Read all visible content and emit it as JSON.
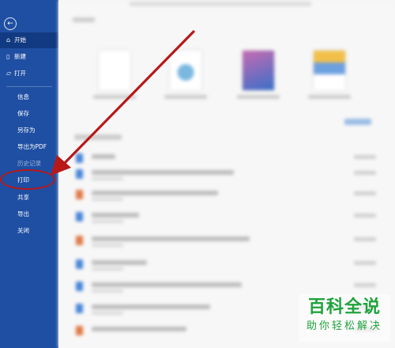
{
  "sidebar": {
    "back_icon": "back-arrow-icon",
    "items": [
      {
        "label": "开始",
        "icon": "home-icon",
        "glyph": "⌂"
      },
      {
        "label": "新建",
        "icon": "new-file-icon",
        "glyph": "▯"
      },
      {
        "label": "打开",
        "icon": "open-folder-icon",
        "glyph": "▱"
      },
      {
        "label": "信息"
      },
      {
        "label": "保存"
      },
      {
        "label": "另存为"
      },
      {
        "label": "导出为PDF"
      },
      {
        "label": "历史记录"
      },
      {
        "label": "打印"
      },
      {
        "label": "共享"
      },
      {
        "label": "导出"
      },
      {
        "label": "关闭"
      }
    ],
    "active_index": 0,
    "highlighted_label": "打印"
  },
  "annotation": {
    "color": "#b81818"
  },
  "watermark": {
    "line1": "百科全说",
    "line2": "助你轻松解决",
    "color": "#1fa33d"
  },
  "colors": {
    "sidebar_bg": "#1f4fa3",
    "sidebar_active": "#123a82"
  }
}
